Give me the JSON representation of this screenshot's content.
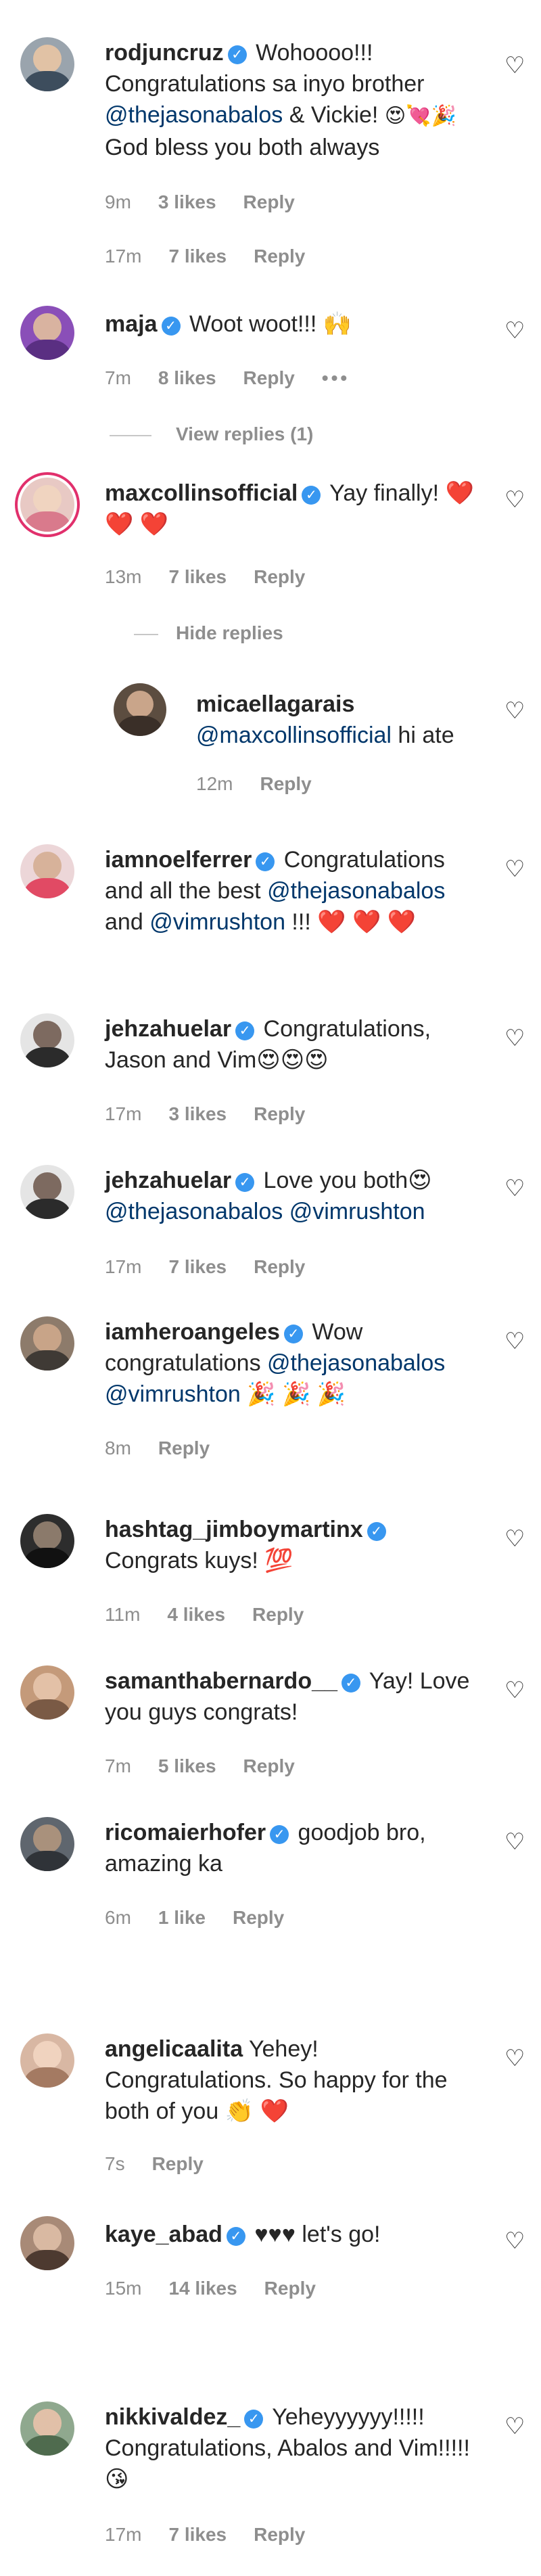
{
  "comments": [
    {
      "user": "rodjuncruz",
      "text_parts": [
        "Wohoooo!!! Congratulations sa inyo brother ",
        "@thejasonabalos",
        " & Vickie! ",
        "😍💘🎉",
        " God bless you both always"
      ],
      "time": "9m",
      "likes": "3 likes",
      "reply": "Reply",
      "time2": "17m",
      "likes2": "7 likes",
      "reply2": "Reply",
      "avatar_color": "#5d6d7a"
    },
    {
      "user": "maja",
      "text": "Woot woot!!! 🙌",
      "time": "7m",
      "likes": "8 likes",
      "reply": "Reply",
      "more": "•••",
      "view_replies": "View replies (1)",
      "avatar_color": "#7b5aa6"
    },
    {
      "user": "maxcollinsofficial",
      "text": "Yay finally! ❤️ ❤️ ❤️",
      "time": "13m",
      "likes": "7 likes",
      "reply": "Reply",
      "hide_replies": "Hide replies",
      "avatar_color": "#d9a3a6"
    },
    {
      "user": "micaellagarais",
      "mention": "@maxcollinsofficial",
      "text": " hi ate",
      "time": "12m",
      "reply": "Reply",
      "avatar_color": "#6a5a4a"
    },
    {
      "user": "iamnoelferrer",
      "text_parts": [
        "Congratulations and all the best ",
        "@thejasonabalos",
        " and ",
        "@vimrushton",
        " !!! ❤️ ❤️ ❤️"
      ],
      "avatar_color": "#e36a7b"
    },
    {
      "user": "jehzahuelar",
      "text": "Congratulations, Jason and Vim😍😍😍",
      "time": "17m",
      "likes": "3 likes",
      "reply": "Reply",
      "avatar_color": "#4a4a4a"
    },
    {
      "user": "jehzahuelar",
      "text_parts": [
        "Love you both😍 ",
        "@thejasonabalos",
        " ",
        "@vimrushton"
      ],
      "time": "17m",
      "likes": "7 likes",
      "reply": "Reply",
      "avatar_color": "#4a4a4a"
    },
    {
      "user": "iamheroangeles",
      "text_parts": [
        "Wow congratulations ",
        "@thejasonabalos",
        " ",
        "@vimrushton",
        " 🎉 🎉 🎉"
      ],
      "time": "8m",
      "reply": "Reply",
      "avatar_color": "#7a6b5c"
    },
    {
      "user": "hashtag_jimboymartinx",
      "text": "Congrats kuys! 💯",
      "time": "11m",
      "likes": "4 likes",
      "reply": "Reply",
      "avatar_color": "#3a3a3a"
    },
    {
      "user": "samanthabernardo__",
      "text": "Yay! Love you guys congrats!",
      "time": "7m",
      "likes": "5 likes",
      "reply": "Reply",
      "avatar_color": "#b58b6a"
    },
    {
      "user": "ricomaierhofer",
      "text": "goodjob bro, amazing ka",
      "time": "6m",
      "likes": "1 like",
      "reply": "Reply",
      "avatar_color": "#5a5f66"
    },
    {
      "user": "angelicaalita",
      "text": "Yehey! Congratulations. So happy for the both of you 👏 ❤️",
      "time": "7s",
      "reply": "Reply",
      "avatar_color": "#c89f8a"
    },
    {
      "user": "kaye_abad",
      "text": "♥♥♥ let's go!",
      "time": "15m",
      "likes": "14 likes",
      "reply": "Reply",
      "avatar_color": "#9a7b6a"
    },
    {
      "user": "nikkivaldez_",
      "text": "Yeheyyyyyy!!!!! Congratulations, Abalos and Vim!!!!! 😘",
      "time": "17m",
      "likes": "7 likes",
      "reply": "Reply",
      "avatar_color": "#6b8a6a"
    }
  ],
  "icons": {
    "heart": "heart-outline-icon",
    "verified": "verified-badge-icon"
  }
}
